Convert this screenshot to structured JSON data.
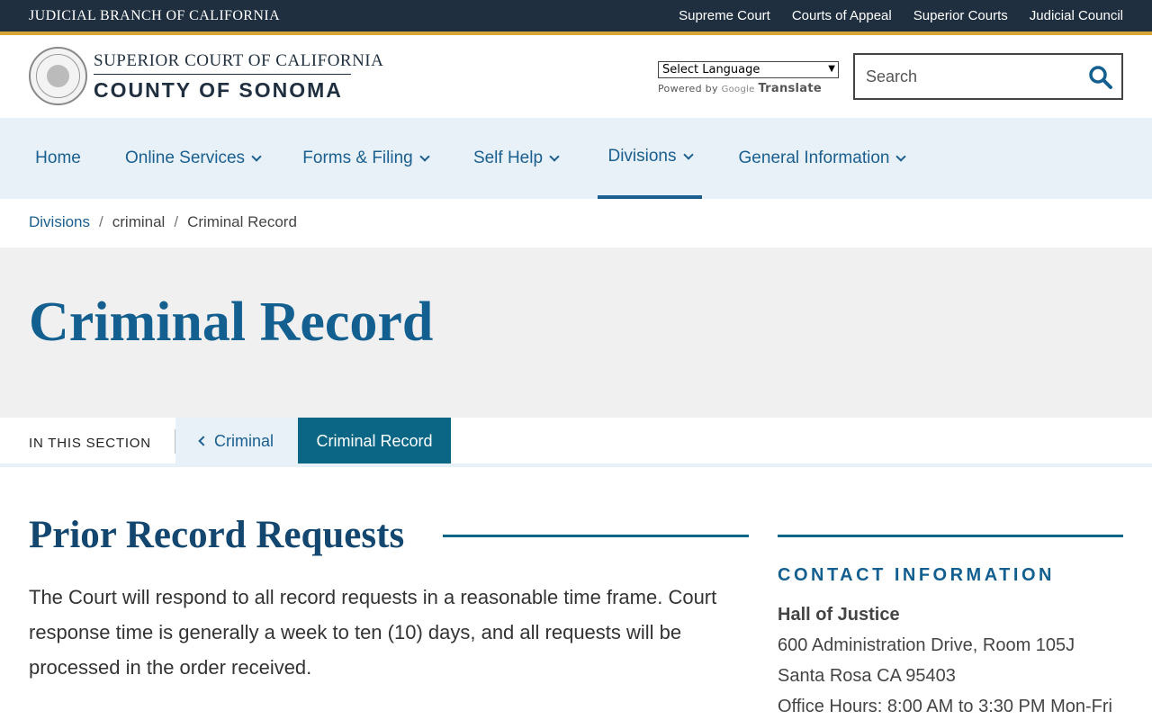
{
  "topbar": {
    "title": "JUDICIAL BRANCH OF CALIFORNIA",
    "links": [
      "Supreme Court",
      "Courts of Appeal",
      "Superior Courts",
      "Judicial Council"
    ]
  },
  "header": {
    "court_line1": "SUPERIOR COURT OF CALIFORNIA",
    "court_line2": "COUNTY OF SONOMA",
    "language_select": "Select Language",
    "powered_by": "Powered by",
    "google": "Google",
    "translate": "Translate",
    "search_placeholder": "Search"
  },
  "nav": {
    "items": [
      {
        "label": "Home"
      },
      {
        "label": "Online Services"
      },
      {
        "label": "Forms & Filing"
      },
      {
        "label": "Self Help"
      },
      {
        "label": "Divisions"
      },
      {
        "label": "General Information"
      }
    ]
  },
  "breadcrumb": [
    "Divisions",
    "criminal",
    "Criminal Record"
  ],
  "page": {
    "title": "Criminal Record"
  },
  "section": {
    "label": "IN THIS SECTION",
    "back": "Criminal",
    "current": "Criminal Record"
  },
  "content": {
    "heading": "Prior Record Requests",
    "body": "The Court will respond to all record requests in a reasonable time frame. Court response time is generally a week to ten (10) days, and all requests will be processed in the order received."
  },
  "sidebar": {
    "heading": "CONTACT INFORMATION",
    "name": "Hall of Justice",
    "address1": "600 Administration Drive, Room 105J",
    "address2": "Santa Rosa CA 95403",
    "hours": "Office Hours: 8:00 AM to 3:30 PM Mon-Fri"
  },
  "colors": {
    "topbar": "#1f2f3f",
    "gold_accent": "#d6a636",
    "brand_blue": "#135f90",
    "nav_bg": "#e8f1f8",
    "teal": "#0b6685"
  }
}
